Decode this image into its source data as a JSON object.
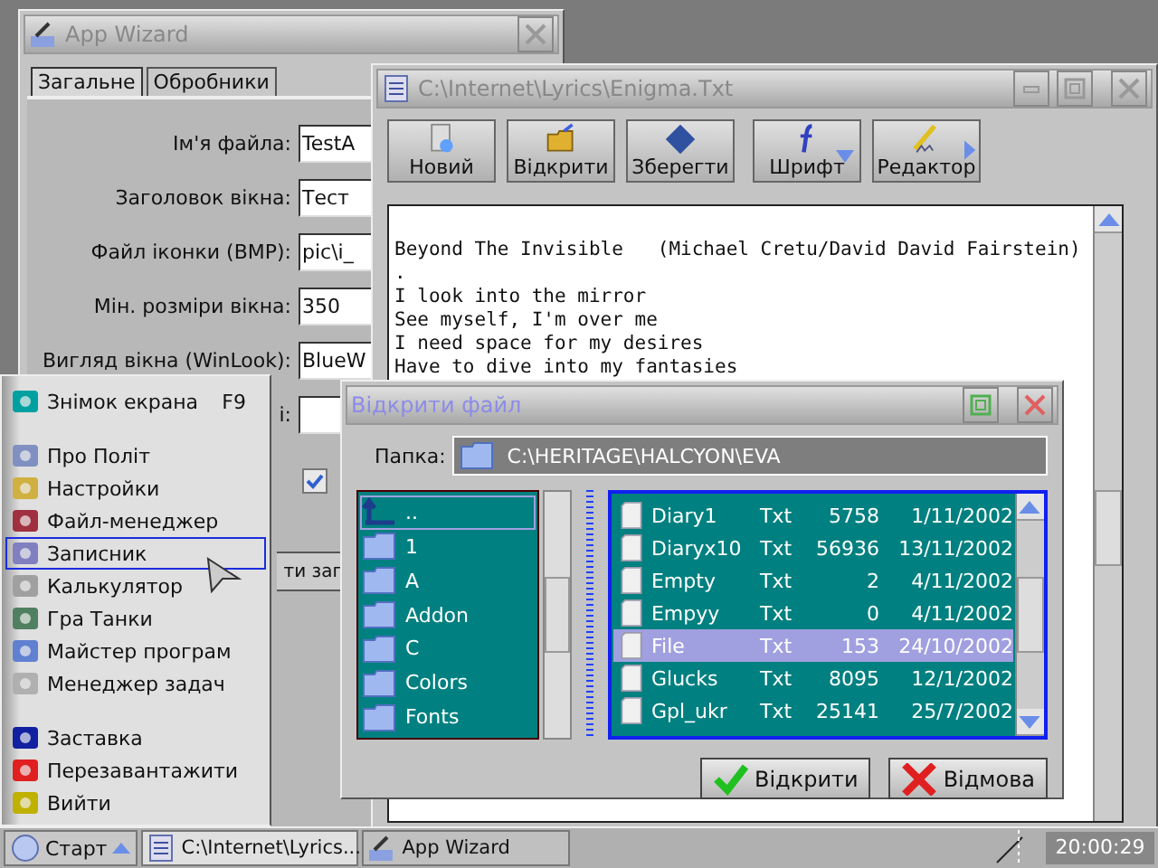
{
  "app_wizard": {
    "title": "App Wizard",
    "tabs": [
      {
        "label": "Загальне",
        "selected": true
      },
      {
        "label": "Обробники",
        "selected": false
      }
    ],
    "fields": [
      {
        "label": "Ім'я файла:",
        "value": "TestA"
      },
      {
        "label": "Заголовок вікна:",
        "value": "Тест"
      },
      {
        "label": "Файл іконки (BMP):",
        "value": "pic\\i_"
      },
      {
        "label": "Мін. розміри вікна:",
        "value": "350"
      },
      {
        "label": "Вигляд вікна (WinLook):",
        "value": "BlueW"
      },
      {
        "label": "і:"
      }
    ],
    "checkbox": {
      "checked": true
    },
    "button": "ти заг"
  },
  "editor": {
    "title": "C:\\Internet\\Lyrics\\Enigma.Txt",
    "toolbar": [
      {
        "label": "Новий",
        "kind": "plain"
      },
      {
        "label": "Відкрити",
        "kind": "plain"
      },
      {
        "label": "Зберегти",
        "kind": "plain"
      },
      {
        "label": "Шрифт",
        "kind": "dropdown"
      },
      {
        "label": "Редактор",
        "kind": "submenu"
      }
    ],
    "lines": [
      "Beyond The Invisible   (Michael Cretu/David David Fairstein)",
      ".",
      "I look into the mirror",
      "See myself, I'm over me",
      "I need space for my desires",
      "Have to dive into my fantasies"
    ]
  },
  "open_dialog": {
    "title": "Відкрити файл",
    "folder_label": "Папка:",
    "folder_path": "C:\\HERITAGE\\HALCYON\\EVA",
    "folders": [
      {
        "name": "..",
        "selected": true
      },
      {
        "name": "1",
        "selected": false
      },
      {
        "name": "A",
        "selected": false
      },
      {
        "name": "Addon",
        "selected": false
      },
      {
        "name": "C",
        "selected": false
      },
      {
        "name": "Colors",
        "selected": false
      },
      {
        "name": "Fonts",
        "selected": false
      }
    ],
    "files": [
      {
        "name": "Diary1",
        "type": "Txt",
        "size": "5758",
        "date": "1/11/2002",
        "selected": false
      },
      {
        "name": "Diaryx10",
        "type": "Txt",
        "size": "56936",
        "date": "13/11/2002",
        "selected": false
      },
      {
        "name": "Empty",
        "type": "Txt",
        "size": "2",
        "date": "4/11/2002",
        "selected": false
      },
      {
        "name": "Empyy",
        "type": "Txt",
        "size": "0",
        "date": "4/11/2002",
        "selected": false
      },
      {
        "name": "File",
        "type": "Txt",
        "size": "153",
        "date": "24/10/2002",
        "selected": true
      },
      {
        "name": "Glucks",
        "type": "Txt",
        "size": "8095",
        "date": "12/1/2002",
        "selected": false
      },
      {
        "name": "Gpl_ukr",
        "type": "Txt",
        "size": "25141",
        "date": "25/7/2002",
        "selected": false
      }
    ],
    "buttons": [
      {
        "label": "Відкрити",
        "kind": "ok"
      },
      {
        "label": "Відмова",
        "kind": "cancel"
      }
    ]
  },
  "start_menu": {
    "groups": [
      [
        {
          "label": "Знімок екрана",
          "shortcut": "F9",
          "selected": false
        }
      ],
      [
        {
          "label": "Про Політ",
          "selected": false
        },
        {
          "label": "Настройки",
          "selected": false
        },
        {
          "label": "Файл-менеджер",
          "selected": false
        },
        {
          "label": "Записник",
          "selected": true
        },
        {
          "label": "Калькулятор",
          "selected": false
        },
        {
          "label": "Гра Танки",
          "selected": false
        },
        {
          "label": "Майстер програм",
          "selected": false
        },
        {
          "label": "Менеджер задач",
          "selected": false
        }
      ],
      [
        {
          "label": "Заставка",
          "selected": false
        },
        {
          "label": "Перезавантажити",
          "selected": false
        },
        {
          "label": "Вийти",
          "selected": false
        }
      ]
    ]
  },
  "taskbar": {
    "start": "Старт",
    "tasks": [
      {
        "label": "C:\\Internet\\Lyrics...",
        "selected": true
      },
      {
        "label": "App Wizard",
        "selected": false
      }
    ],
    "clock": "20:00:29"
  }
}
